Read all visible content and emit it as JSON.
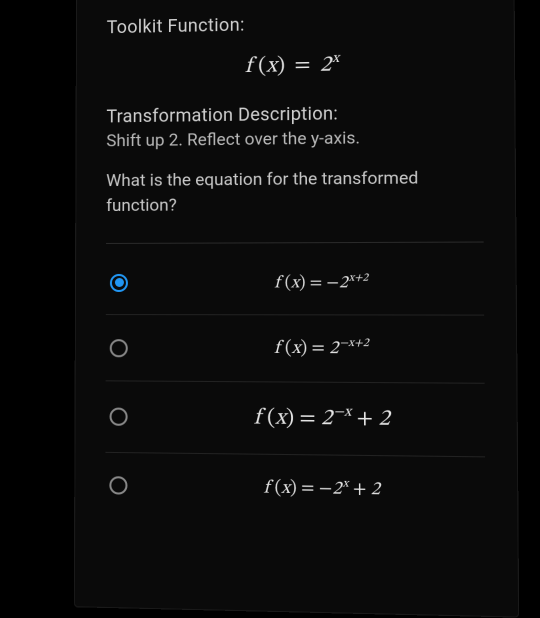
{
  "heading": "Toolkit Function:",
  "toolkit_formula_html": "<span class='func'>f</span> <span class='paren'>(</span><span>x</span><span class='paren'>)</span> <span class='eq'>=</span> 2<sup>x</sup>",
  "sub_heading": "Transformation Description:",
  "description": "Shift up 2. Reflect over the y-axis.",
  "question": "What is the equation for the transformed function?",
  "options": [
    {
      "id": "opt-a",
      "selected": true,
      "size_class": "sz1",
      "formula_html": "<span class='func'>f</span> <span class='paren'>(</span>x<span class='paren'>)</span> <span class='eq'>=</span> <span class='op'>−</span>2<sup>x+2</sup>"
    },
    {
      "id": "opt-b",
      "selected": false,
      "size_class": "sz2",
      "formula_html": "<span class='func'>f</span> <span class='paren'>(</span>x<span class='paren'>)</span> <span class='eq'>=</span> 2<sup>−x+2</sup>"
    },
    {
      "id": "opt-c",
      "selected": false,
      "size_class": "sz3",
      "formula_html": "<span class='func'>f</span> <span class='paren'>(</span>x<span class='paren'>)</span> <span class='eq'>=</span> 2<sup>−x</sup> <span class='op'>+</span> 2"
    },
    {
      "id": "opt-d",
      "selected": false,
      "size_class": "sz4",
      "formula_html": "<span class='func'>f</span> <span class='paren'>(</span>x<span class='paren'>)</span> <span class='eq'>=</span> <span class='op'>−</span>2<sup>x</sup> <span class='op'>+</span> 2"
    }
  ]
}
